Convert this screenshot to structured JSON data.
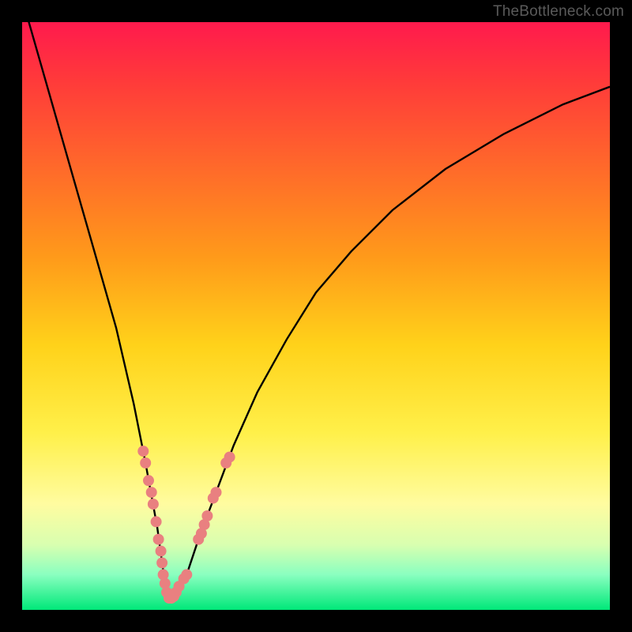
{
  "watermark": "TheBottleneck.com",
  "colors": {
    "background": "#000000",
    "curve_stroke": "#000000",
    "dot_fill": "#e98080",
    "gradient_stops": [
      "#ff1a4d",
      "#ff3a3a",
      "#ff6a2a",
      "#ff9a1a",
      "#ffd21a",
      "#fff04a",
      "#fffca0",
      "#d8ffb0",
      "#8affc0",
      "#00e879"
    ]
  },
  "chart_data": {
    "type": "line",
    "title": "",
    "xlabel": "",
    "ylabel": "",
    "xlim": [
      0,
      100
    ],
    "ylim": [
      0,
      100
    ],
    "series": [
      {
        "name": "bottleneck-curve",
        "x": [
          0,
          4,
          8,
          12,
          16,
          19,
          21,
          23,
          24.3,
          25,
          26,
          28,
          30,
          33,
          36,
          40,
          45,
          50,
          56,
          63,
          72,
          82,
          92,
          100
        ],
        "y": [
          104,
          90,
          76,
          62,
          48,
          35,
          25,
          14,
          4.5,
          2,
          2.5,
          6,
          12,
          20,
          28,
          37,
          46,
          54,
          61,
          68,
          75,
          81,
          86,
          89
        ]
      }
    ],
    "dots": {
      "name": "highlighted-points",
      "points": [
        {
          "x": 20.6,
          "y": 27
        },
        {
          "x": 21.0,
          "y": 25
        },
        {
          "x": 21.5,
          "y": 22
        },
        {
          "x": 22.0,
          "y": 20
        },
        {
          "x": 22.3,
          "y": 18
        },
        {
          "x": 22.8,
          "y": 15
        },
        {
          "x": 23.2,
          "y": 12
        },
        {
          "x": 23.6,
          "y": 10
        },
        {
          "x": 23.8,
          "y": 8
        },
        {
          "x": 24.0,
          "y": 6
        },
        {
          "x": 24.3,
          "y": 4.5
        },
        {
          "x": 24.6,
          "y": 3
        },
        {
          "x": 25.0,
          "y": 2
        },
        {
          "x": 25.4,
          "y": 2
        },
        {
          "x": 25.8,
          "y": 2.3
        },
        {
          "x": 26.2,
          "y": 3
        },
        {
          "x": 26.7,
          "y": 4
        },
        {
          "x": 27.5,
          "y": 5.3
        },
        {
          "x": 28.0,
          "y": 6
        },
        {
          "x": 30.0,
          "y": 12
        },
        {
          "x": 30.5,
          "y": 13
        },
        {
          "x": 31.0,
          "y": 14.5
        },
        {
          "x": 31.5,
          "y": 16
        },
        {
          "x": 32.5,
          "y": 19
        },
        {
          "x": 33.0,
          "y": 20
        },
        {
          "x": 34.7,
          "y": 25
        },
        {
          "x": 35.3,
          "y": 26
        }
      ]
    }
  }
}
